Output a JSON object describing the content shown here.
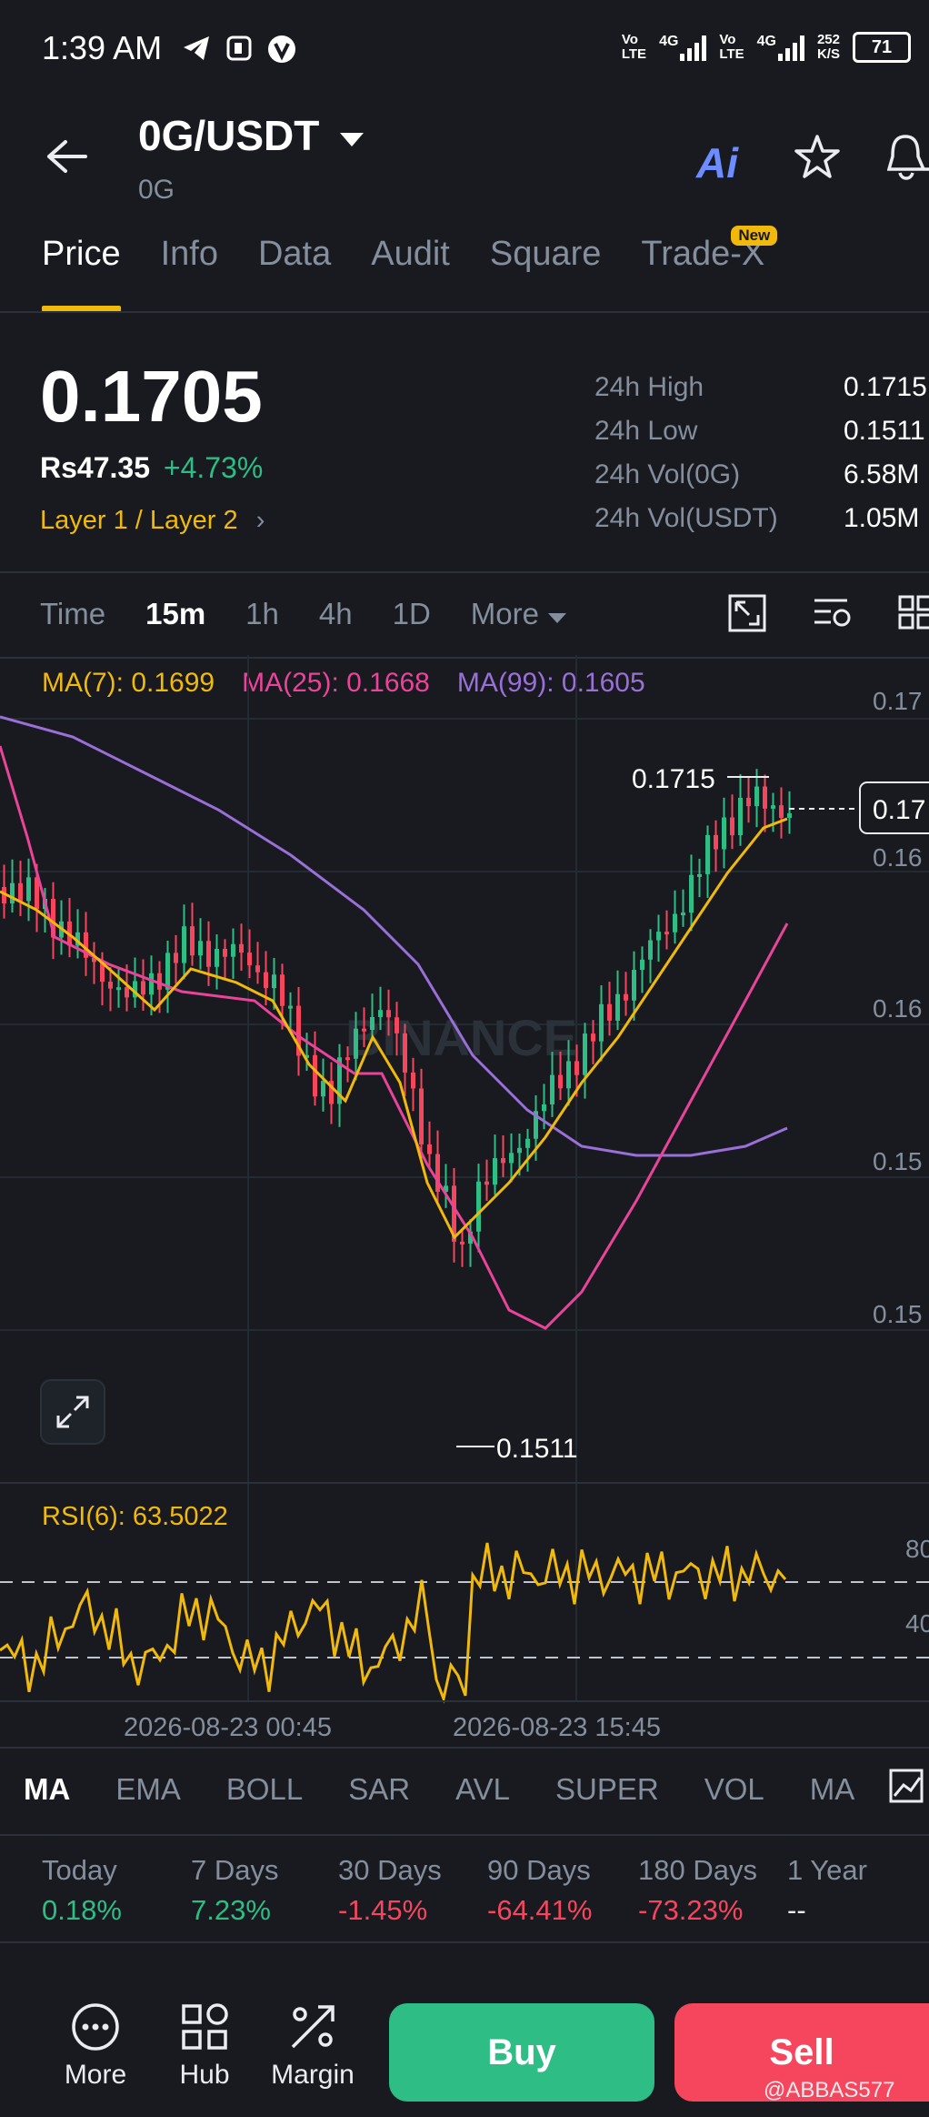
{
  "status_bar": {
    "time": "1:39 AM",
    "net1": [
      "Vo",
      "LTE"
    ],
    "net1_gen": "4G",
    "net2": [
      "Vo",
      "LTE"
    ],
    "net2_gen": "4G",
    "speed_top": "252",
    "speed_bottom": "K/S",
    "battery": "71"
  },
  "header": {
    "pair": "0G/USDT",
    "base": "0G",
    "ai_label": "Ai"
  },
  "tabs": [
    {
      "label": "Price",
      "active": true
    },
    {
      "label": "Info"
    },
    {
      "label": "Data"
    },
    {
      "label": "Audit"
    },
    {
      "label": "Square"
    },
    {
      "label": "Trade-X",
      "badge": "New"
    }
  ],
  "price": {
    "last": "0.1705",
    "fiat": "Rs47.35",
    "change": "+4.73%",
    "category": "Layer 1 / Layer 2"
  },
  "stats": [
    {
      "label": "24h High",
      "value": "0.1715"
    },
    {
      "label": "24h Low",
      "value": "0.1511"
    },
    {
      "label": "24h Vol(0G)",
      "value": "6.58M"
    },
    {
      "label": "24h Vol(USDT)",
      "value": "1.05M"
    }
  ],
  "intervals": [
    "Time",
    "15m",
    "1h",
    "4h",
    "1D",
    "More"
  ],
  "selected_interval": "15m",
  "ma_legend": {
    "ma7": "MA(7): 0.1699",
    "ma25": "MA(25): 0.1668",
    "ma99": "MA(99): 0.1605"
  },
  "colors": {
    "up": "#2ebd85",
    "down": "#f6465d",
    "ma7": "#f0b90b",
    "ma25": "#e9449a",
    "ma99": "#9a6fd8",
    "accent": "#f0b90b"
  },
  "chart": {
    "high_label": "0.1715",
    "low_label": "0.1511",
    "y_ticks": [
      "0.17",
      "0.16",
      "0.16",
      "0.15",
      "0.15"
    ],
    "current_price_tag": "0.17",
    "watermark": "BINANCE",
    "rsi_label": "RSI(6): 63.5022",
    "rsi_ticks": [
      "80",
      "40"
    ],
    "x_labels": [
      "2026-08-23 00:45",
      "2026-08-23 15:45"
    ]
  },
  "indicator_tabs": [
    "MA",
    "EMA",
    "BOLL",
    "SAR",
    "AVL",
    "SUPER",
    "VOL",
    "MA"
  ],
  "selected_indicator": "MA",
  "performance": [
    {
      "label": "Today",
      "value": "0.18%",
      "trend": "up"
    },
    {
      "label": "7 Days",
      "value": "7.23%",
      "trend": "up"
    },
    {
      "label": "30 Days",
      "value": "-1.45%",
      "trend": "down"
    },
    {
      "label": "90 Days",
      "value": "-64.41%",
      "trend": "down"
    },
    {
      "label": "180 Days",
      "value": "-73.23%",
      "trend": "down"
    },
    {
      "label": "1 Year",
      "value": "--",
      "trend": "none"
    }
  ],
  "bottom_nav": {
    "more": "More",
    "hub": "Hub",
    "margin": "Margin",
    "buy": "Buy",
    "sell": "Sell",
    "watermark_user": "@ABBAS577"
  }
}
